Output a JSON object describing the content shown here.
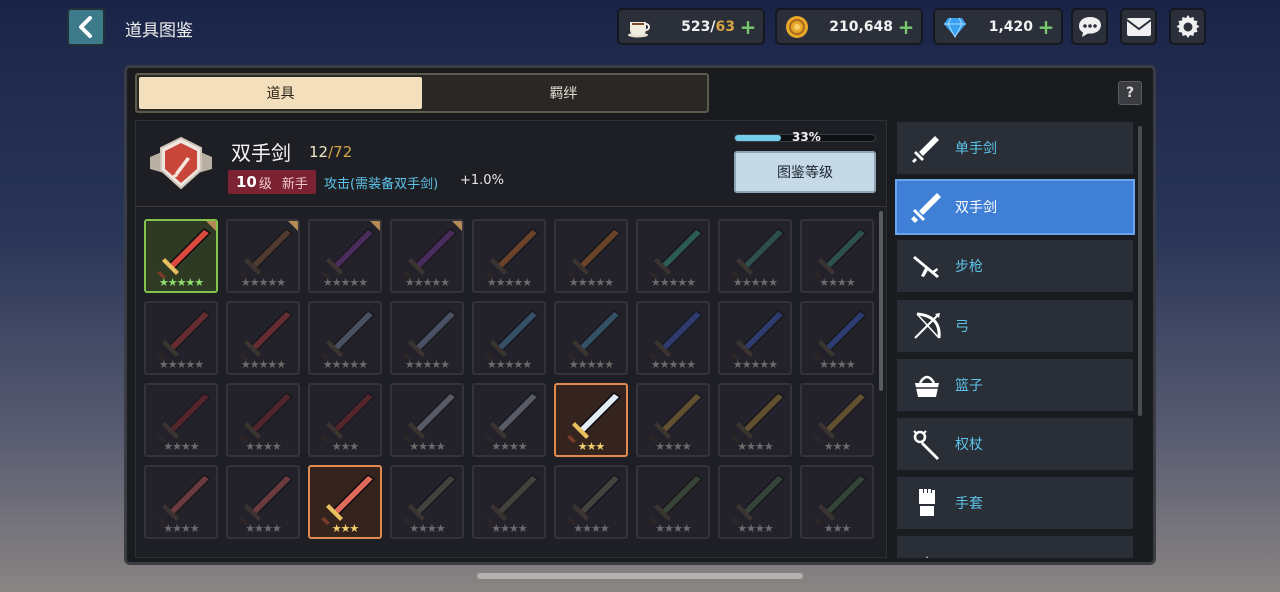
{
  "header": {
    "title": "道具图鉴"
  },
  "resources": {
    "stamina": {
      "current": "523",
      "separator": "/",
      "max": "63",
      "icon": "coffee-cup-icon"
    },
    "gold": {
      "value": "210,648",
      "icon": "gold-coin-icon"
    },
    "gems": {
      "value": "1,420",
      "icon": "diamond-icon"
    },
    "plus": "+"
  },
  "tabs": [
    {
      "label": "道具",
      "active": true
    },
    {
      "label": "羁绊",
      "active": false
    }
  ],
  "help_label": "?",
  "category": {
    "name": "双手剑",
    "collected": "12",
    "total": "72",
    "slash": "/",
    "level_num": "10",
    "level_unit": "级",
    "rank": "新手",
    "effect": "攻击(需装备双手剑)",
    "effect_value": "+1.0%",
    "progress_text": "33%",
    "progress": 0.33,
    "codex_button": "图鉴等级"
  },
  "grid_items": [
    {
      "stars": "★★★★★",
      "state": "green",
      "color": "#d94a3a",
      "corner": true
    },
    {
      "stars": "★★★★★",
      "state": "locked",
      "color": "#8a5a3a",
      "corner": true
    },
    {
      "stars": "★★★★★",
      "state": "locked",
      "color": "#7a3a9a",
      "corner": true
    },
    {
      "stars": "★★★★★",
      "state": "locked",
      "color": "#7a3a9a",
      "corner": true
    },
    {
      "stars": "★★★★★",
      "state": "locked",
      "color": "#c46a2a",
      "corner": false
    },
    {
      "stars": "★★★★★",
      "state": "locked",
      "color": "#c46a2a",
      "corner": false
    },
    {
      "stars": "★★★★★",
      "state": "locked",
      "color": "#3aa08a",
      "corner": false
    },
    {
      "stars": "★★★★★",
      "state": "locked",
      "color": "#3a8a7a",
      "corner": false
    },
    {
      "stars": "★★★★",
      "state": "locked",
      "color": "#3a8a7a",
      "corner": false
    },
    {
      "stars": "★★★★★",
      "state": "locked",
      "color": "#b53a3a",
      "corner": false
    },
    {
      "stars": "★★★★★",
      "state": "locked",
      "color": "#b53a3a",
      "corner": false
    },
    {
      "stars": "★★★★★",
      "state": "locked",
      "color": "#7a8aa6",
      "corner": false
    },
    {
      "stars": "★★★★★",
      "state": "locked",
      "color": "#7a8aa6",
      "corner": false
    },
    {
      "stars": "★★★★★",
      "state": "locked",
      "color": "#4a8ab0",
      "corner": false
    },
    {
      "stars": "★★★★★",
      "state": "locked",
      "color": "#4a8ab0",
      "corner": false
    },
    {
      "stars": "★★★★★",
      "state": "locked",
      "color": "#3a5ac4",
      "corner": false
    },
    {
      "stars": "★★★★★",
      "state": "locked",
      "color": "#3a5ac4",
      "corner": false
    },
    {
      "stars": "★★★★",
      "state": "locked",
      "color": "#3a5ac4",
      "corner": false
    },
    {
      "stars": "★★★★",
      "state": "locked",
      "color": "#8a2a2a",
      "corner": false
    },
    {
      "stars": "★★★★",
      "state": "locked",
      "color": "#8a2a2a",
      "corner": false
    },
    {
      "stars": "★★★",
      "state": "locked",
      "color": "#8a2a2a",
      "corner": false
    },
    {
      "stars": "★★★★",
      "state": "locked",
      "color": "#9aa0b0",
      "corner": false
    },
    {
      "stars": "★★★★",
      "state": "locked",
      "color": "#9aa0b0",
      "corner": false
    },
    {
      "stars": "★★★",
      "state": "orange",
      "color": "#e6ecf6",
      "corner": false
    },
    {
      "stars": "★★★★",
      "state": "locked",
      "color": "#b08a3a",
      "corner": false
    },
    {
      "stars": "★★★★",
      "state": "locked",
      "color": "#b08a3a",
      "corner": false
    },
    {
      "stars": "★★★",
      "state": "locked",
      "color": "#b08a3a",
      "corner": false
    },
    {
      "stars": "★★★★",
      "state": "locked",
      "color": "#c45a5a",
      "corner": false
    },
    {
      "stars": "★★★★",
      "state": "locked",
      "color": "#c45a5a",
      "corner": false
    },
    {
      "stars": "★★★",
      "state": "orange",
      "color": "#e06a5a",
      "corner": false
    },
    {
      "stars": "★★★★",
      "state": "locked",
      "color": "#6a6a5a",
      "corner": false
    },
    {
      "stars": "★★★★",
      "state": "locked",
      "color": "#6a6a5a",
      "corner": false
    },
    {
      "stars": "★★★★",
      "state": "locked",
      "color": "#6a6a5a",
      "corner": false
    },
    {
      "stars": "★★★★",
      "state": "locked",
      "color": "#4a6a4a",
      "corner": false
    },
    {
      "stars": "★★★★",
      "state": "locked",
      "color": "#4a6a4a",
      "corner": false
    },
    {
      "stars": "★★★",
      "state": "locked",
      "color": "#4a6a4a",
      "corner": false
    }
  ],
  "side_categories": [
    {
      "label": "单手剑",
      "icon": "one-hand-sword-icon",
      "active": false
    },
    {
      "label": "双手剑",
      "icon": "two-hand-sword-icon",
      "active": true
    },
    {
      "label": "步枪",
      "icon": "rifle-icon",
      "active": false
    },
    {
      "label": "弓",
      "icon": "bow-icon",
      "active": false
    },
    {
      "label": "篮子",
      "icon": "basket-icon",
      "active": false
    },
    {
      "label": "权杖",
      "icon": "staff-icon",
      "active": false
    },
    {
      "label": "手套",
      "icon": "gauntlet-icon",
      "active": false
    },
    {
      "label": "",
      "icon": "more-icon",
      "active": false
    }
  ]
}
